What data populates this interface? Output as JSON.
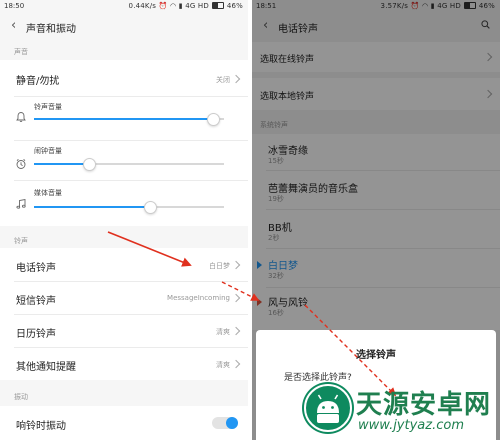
{
  "left": {
    "status": {
      "time": "18:50",
      "speed": "0.44K/s",
      "network": "4G HD",
      "battery": "46%"
    },
    "title": "声音和振动",
    "sections": {
      "sound": "声音",
      "ringtone": "铃声",
      "vibrate": "振动"
    },
    "dnd": {
      "label": "静音/勿扰",
      "value": "关闭"
    },
    "volumes": [
      {
        "label": "铃声音量",
        "level": 0.94,
        "icon": "bell-icon"
      },
      {
        "label": "闹钟音量",
        "level": 0.29,
        "icon": "alarm-clock-icon"
      },
      {
        "label": "媒体音量",
        "level": 0.61,
        "icon": "music-note-icon"
      }
    ],
    "ringtones": [
      {
        "label": "电话铃声",
        "value": "白日梦"
      },
      {
        "label": "短信铃声",
        "value": "MessageIncoming"
      },
      {
        "label": "日历铃声",
        "value": "清爽"
      },
      {
        "label": "其他通知提醒",
        "value": "清爽"
      }
    ],
    "vibrate_on_ring": {
      "label": "响铃时振动",
      "on": true
    }
  },
  "right": {
    "status": {
      "time": "18:51",
      "speed": "3.57K/s",
      "network": "4G HD",
      "battery": "46%"
    },
    "title": "电话铃声",
    "online": "选取在线铃声",
    "local": "选取本地铃声",
    "system_label": "系统铃声",
    "ringtones": [
      {
        "name": "冰雪奇缘",
        "duration": "15秒",
        "selected": false
      },
      {
        "name": "芭蕾舞演员的音乐盒",
        "duration": "19秒",
        "selected": false
      },
      {
        "name": "BB机",
        "duration": "2秒",
        "selected": false
      },
      {
        "name": "白日梦",
        "duration": "32秒",
        "selected": true
      },
      {
        "name": "风与风铃",
        "duration": "16秒",
        "selected": false
      }
    ],
    "dialog": {
      "title": "选择铃声",
      "message": "是否选择此铃声?"
    }
  },
  "watermark": {
    "title": "天源安卓网",
    "url": "www.jytyaz.com"
  },
  "colors": {
    "accent": "#2196f3",
    "annotation": "#e0301e",
    "watermark": "#1f7f4f"
  }
}
